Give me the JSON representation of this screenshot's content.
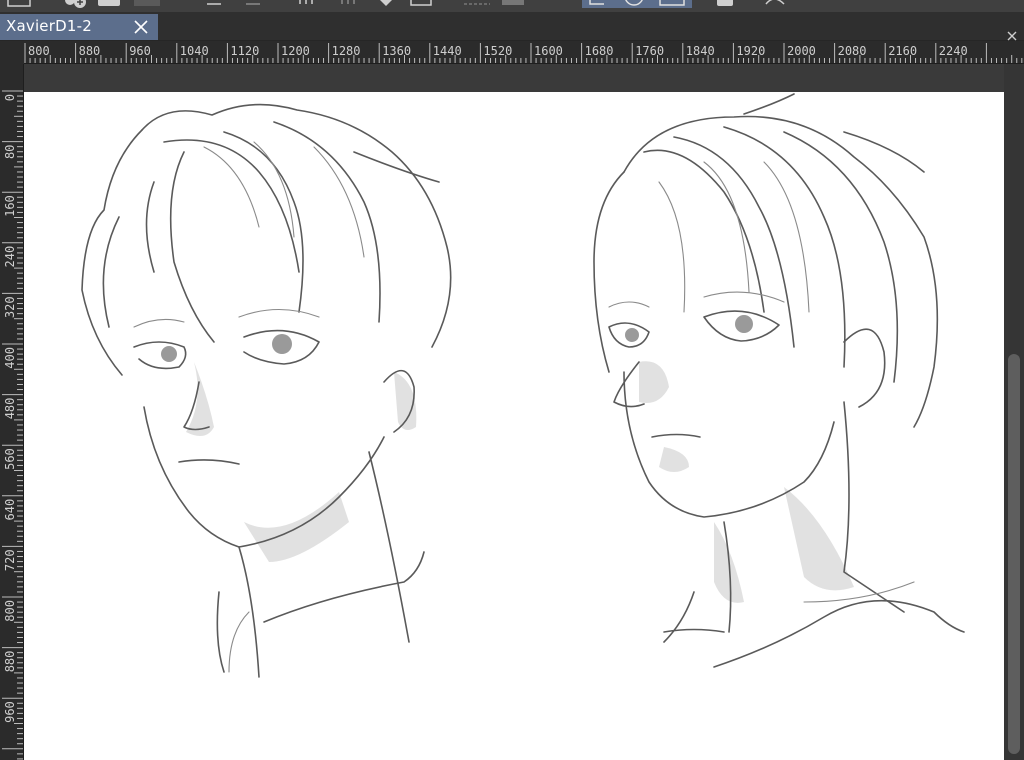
{
  "document": {
    "tab_title": "XavierD1-2"
  },
  "rulers": {
    "horizontal_labels": [
      "800",
      "880",
      "960",
      "1040",
      "1120",
      "1200",
      "1280",
      "1360",
      "1440",
      "1520",
      "1600",
      "1680",
      "1760",
      "1840",
      "1920",
      "2000",
      "2080",
      "2160",
      "2240"
    ],
    "vertical_labels": [
      "0",
      "80",
      "160",
      "240",
      "320",
      "400",
      "480",
      "560",
      "640",
      "720",
      "800",
      "880",
      "960"
    ]
  },
  "icons": {
    "tab_close": "close-icon",
    "panel_close": "close-icon"
  },
  "colors": {
    "tab_active": "#5c6e8c",
    "canvas": "#ffffff",
    "ruler_bg": "#2b2b2b",
    "workspace": "#3a3a3a"
  }
}
